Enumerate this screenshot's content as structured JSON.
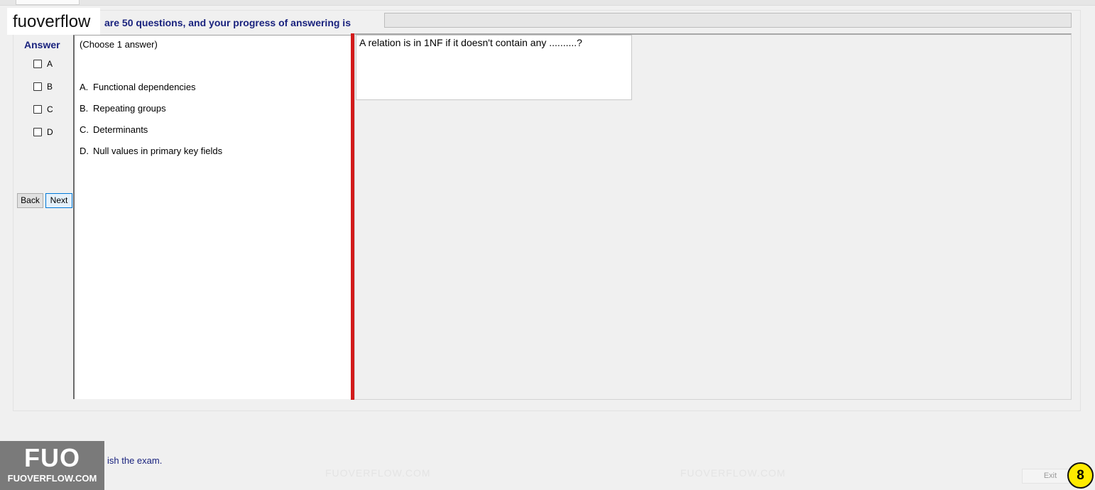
{
  "app": {
    "logo_text": "fuoverflow"
  },
  "progress": {
    "label": "are 50 questions, and your progress of answering is",
    "fraction": 0.0
  },
  "answer_sheet": {
    "title": "Answer",
    "options": [
      {
        "letter": "A",
        "checked": false
      },
      {
        "letter": "B",
        "checked": false
      },
      {
        "letter": "C",
        "checked": false
      },
      {
        "letter": "D",
        "checked": false
      }
    ],
    "back_label": "Back",
    "next_label": "Next"
  },
  "answers_panel": {
    "instruction": "(Choose 1 answer)",
    "answers": [
      {
        "letter": "A.",
        "text": "Functional dependencies"
      },
      {
        "letter": "B.",
        "text": "Repeating groups"
      },
      {
        "letter": "C.",
        "text": "Determinants"
      },
      {
        "letter": "D.",
        "text": "Null values in primary key fields"
      }
    ]
  },
  "question": {
    "text": "A relation is in 1NF if it doesn't contain any ..........?"
  },
  "watermark": {
    "text": "FUOVERFLOW.COM"
  },
  "footer": {
    "finish_label": "ish the exam.",
    "exit_label": "Exit",
    "badge_big": "FUO",
    "badge_small": "FUOVERFLOW.COM",
    "page_number": "8"
  },
  "colors": {
    "accent_navy": "#1a237e",
    "splitter_red": "#d21b1b",
    "badge_yellow": "#ffeb00",
    "next_focus_blue": "#0078d7"
  },
  "icons": {
    "answer_checkbox": "checkbox-icon",
    "finish_checkbox": "checkbox-icon"
  }
}
